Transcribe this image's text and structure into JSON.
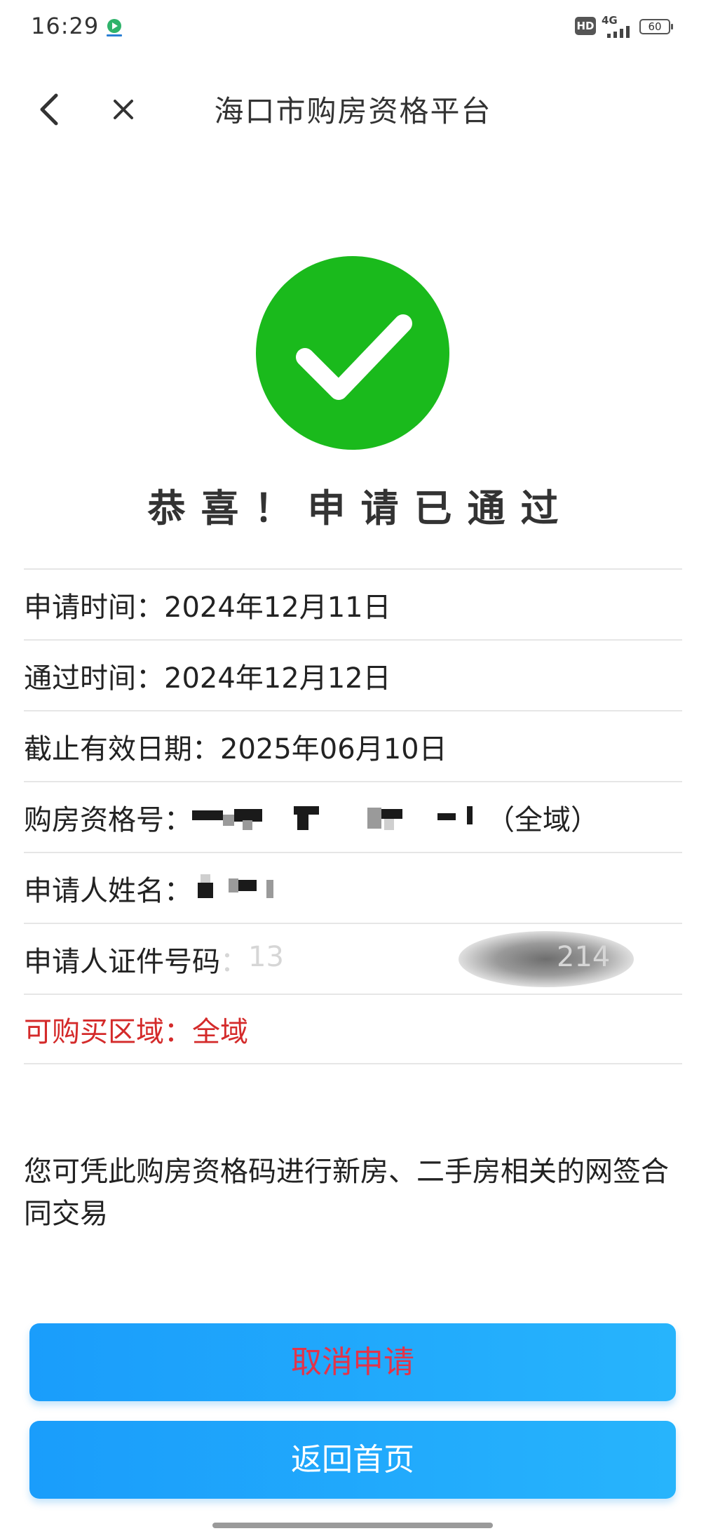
{
  "status_bar": {
    "time": "16:29",
    "hd_label": "HD",
    "network_label": "4G",
    "battery_level": "60"
  },
  "nav": {
    "title": "海口市购房资格平台",
    "back_icon": "chevron-left-icon",
    "close_icon": "close-icon"
  },
  "result": {
    "icon": "check-circle-icon",
    "icon_color": "#1aba1c",
    "title": "恭喜！申请已通过"
  },
  "info": {
    "apply_time": {
      "label": "申请时间",
      "value": "2024年12月11日"
    },
    "pass_time": {
      "label": "通过时间",
      "value": "2024年12月12日"
    },
    "expiry": {
      "label": "截止有效日期",
      "value": "2025年06月10日"
    },
    "qualification_no": {
      "label": "购房资格号",
      "suffix": "（全域）"
    },
    "applicant_name": {
      "label": "申请人姓名"
    },
    "id_number": {
      "label": "申请人证件号码",
      "visible_prefix": "13",
      "visible_suffix": "214"
    },
    "region": {
      "label": "可购买区域",
      "value": "全域"
    },
    "colon": "："
  },
  "note": "您可凭此购房资格码进行新房、二手房相关的网签合同交易",
  "buttons": {
    "cancel": "取消申请",
    "home": "返回首页"
  },
  "colors": {
    "accent_blue": "#1a9dfb",
    "cancel_text": "#e2344a",
    "region_red": "#d42a2a",
    "success_green": "#1aba1c"
  }
}
